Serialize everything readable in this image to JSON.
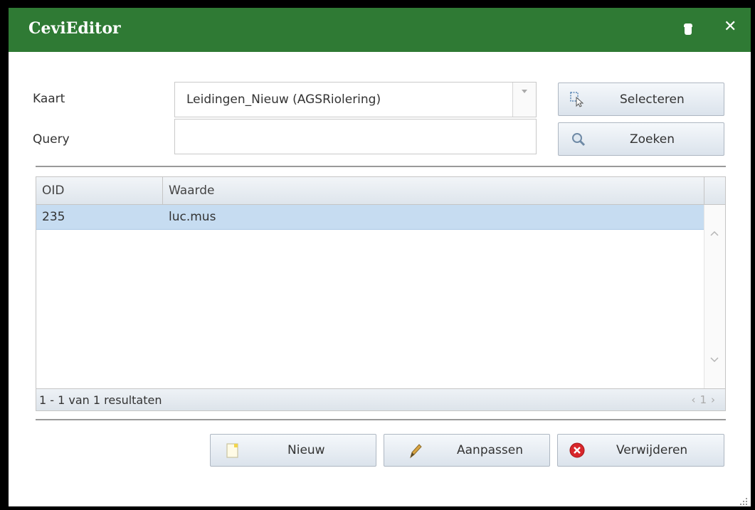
{
  "window": {
    "title": "CeviEditor",
    "pin_icon": "pin-icon",
    "close_icon": "close-icon",
    "close_glyph": "✕"
  },
  "form": {
    "kaart_label": "Kaart",
    "kaart_value": "Leidingen_Nieuw (AGSRiolering)",
    "query_label": "Query",
    "query_value": ""
  },
  "actions": {
    "select_label": "Selecteren",
    "search_label": "Zoeken"
  },
  "grid": {
    "columns": [
      "OID",
      "Waarde"
    ],
    "rows": [
      {
        "oid": "235",
        "waarde": "luc.mus"
      }
    ],
    "footer_count": "1 - 1 van 1 resultaten",
    "pager": {
      "prev": "‹",
      "page": "1",
      "next": "›"
    }
  },
  "bottom_buttons": {
    "new_label": "Nieuw",
    "edit_label": "Aanpassen",
    "delete_label": "Verwijderen"
  },
  "colors": {
    "titlebar": "#2f7a34",
    "selected_row": "#c6dcf1",
    "delete_red": "#d8262b"
  }
}
